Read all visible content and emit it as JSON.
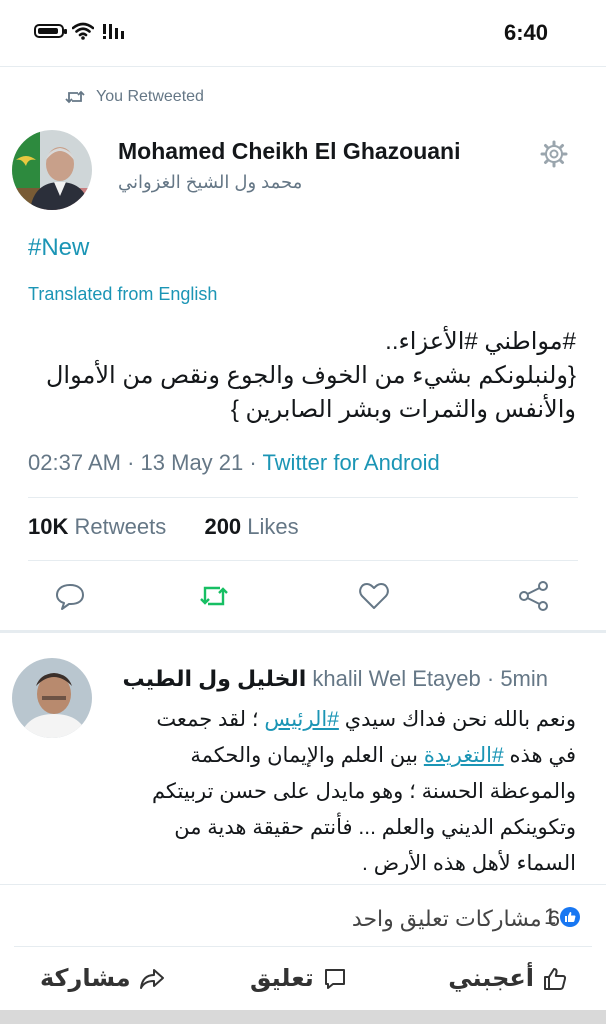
{
  "status_bar": {
    "time": "6:40"
  },
  "retweet": {
    "label": "You Retweeted"
  },
  "tweet": {
    "author_name": "Mohamed Cheikh El Ghazouani",
    "author_handle_ar": "محمد ول الشيخ الغزواني",
    "hashtag": "#New",
    "translated_label": "Translated from English",
    "lines": [
      "#مواطني #الأعزاء..",
      "{ولنبلونكم بشيء من الخوف والجوع ونقص من الأموال",
      "والأنفس والثمرات وبشر الصابرين }"
    ],
    "time": "02:37 AM",
    "date": "13 May 21",
    "source": "Twitter for Android",
    "retweets_count": "10K",
    "retweets_label": "Retweets",
    "likes_count": "200",
    "likes_label": "Likes",
    "icons": [
      "reply-icon",
      "retweet-icon",
      "like-icon",
      "share-icon",
      "gear-icon"
    ],
    "colors": {
      "link": "#1b95b5",
      "retweet_green": "#17bf63",
      "muted": "#657786"
    }
  },
  "comment": {
    "author_ar": "الخليل ول الطيب",
    "author_en": "khalil Wel Etayeb",
    "time": "5min",
    "line1_prefix": "ونعم بالله نحن فداك سيدي ",
    "line1_link": "#الرئيس",
    "line1_suffix": " ؛ لقد جمعت",
    "line2_prefix": "في هذه ",
    "line2_link": "#التغريدة",
    "line2_suffix": " بين العلم والإيمان والحكمة",
    "line3": "والموعظة الحسنة ؛ وهو مايدل على حسن تربيتكم",
    "line4": "وتكوينكم الديني والعلم ... فأنتم حقيقة هدية من",
    "line5": "السماء لأهل هذه الأرض ."
  },
  "facebook": {
    "shares_comments": "6 مشاركات  تعليق واحد",
    "like_count": "1",
    "like_button": "أعجبني",
    "comment_button": "تعليق",
    "share_button": "مشاركة",
    "colors": {
      "like_blue": "#1877f2"
    }
  }
}
